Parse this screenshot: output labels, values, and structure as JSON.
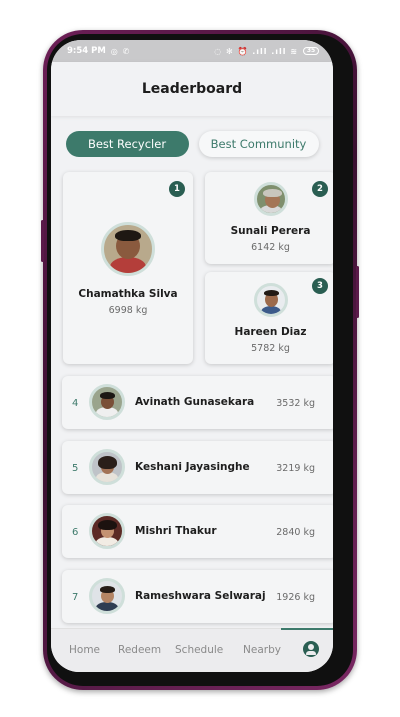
{
  "status_bar": {
    "time": "9:54 PM",
    "left_icons": "◎ ✆",
    "right_icons": "◌ ✻ ⏰ .ıll .ıll ≋",
    "battery": "35"
  },
  "header": {
    "title": "Leaderboard"
  },
  "tabs": [
    {
      "label": "Best Recycler",
      "active": true
    },
    {
      "label": "Best Community",
      "active": false
    }
  ],
  "podium": [
    {
      "rank": "1",
      "name": "Chamathka Silva",
      "weight": "6998 kg"
    },
    {
      "rank": "2",
      "name": "Sunali Perera",
      "weight": "6142 kg"
    },
    {
      "rank": "3",
      "name": "Hareen Diaz",
      "weight": "5782 kg"
    }
  ],
  "list": [
    {
      "rank": "4",
      "name": "Avinath Gunasekara",
      "weight": "3532 kg"
    },
    {
      "rank": "5",
      "name": "Keshani Jayasinghe",
      "weight": "3219 kg"
    },
    {
      "rank": "6",
      "name": "Mishri Thakur",
      "weight": "2840 kg"
    },
    {
      "rank": "7",
      "name": "Rameshwara Selwaraj",
      "weight": "1926 kg"
    }
  ],
  "bottom_nav": [
    {
      "label": "Home"
    },
    {
      "label": "Redeem"
    },
    {
      "label": "Schedule"
    },
    {
      "label": "Nearby"
    }
  ],
  "colors": {
    "accent": "#3d7a6b",
    "accent_dark": "#2a5e52",
    "phone_frame": "#6d1f57",
    "background": "#f1f2f4"
  },
  "icons": {
    "profile": "user-circle-icon",
    "whatsapp": "whatsapp-icon",
    "call": "phone-icon"
  }
}
